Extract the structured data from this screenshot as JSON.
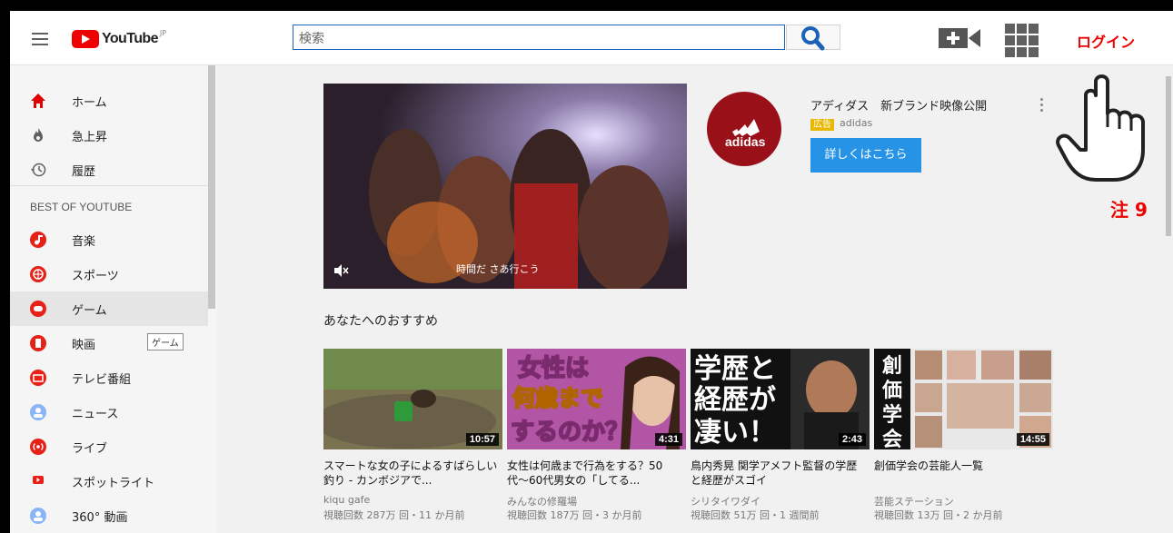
{
  "header": {
    "logo_text": "YouTube",
    "logo_region": "JP",
    "search_placeholder": "検索",
    "login_label": "ログイン"
  },
  "sidebar": {
    "items": [
      {
        "label": "ホーム",
        "icon": "home-icon",
        "color": "#e00000"
      },
      {
        "label": "急上昇",
        "icon": "flame-icon",
        "color": "#606060"
      },
      {
        "label": "履歴",
        "icon": "history-icon",
        "color": "#606060"
      }
    ],
    "section_title": "BEST OF YOUTUBE",
    "best_items": [
      {
        "label": "音楽",
        "icon": "music-icon",
        "color": "#e62117"
      },
      {
        "label": "スポーツ",
        "icon": "sports-icon",
        "color": "#e62117"
      },
      {
        "label": "ゲーム",
        "icon": "gaming-icon",
        "color": "#e62117",
        "active": true
      },
      {
        "label": "映画",
        "icon": "movie-icon",
        "color": "#e62117"
      },
      {
        "label": "テレビ番組",
        "icon": "tv-icon",
        "color": "#e62117"
      },
      {
        "label": "ニュース",
        "icon": "news-icon",
        "color": "#8ab4f8"
      },
      {
        "label": "ライブ",
        "icon": "live-icon",
        "color": "#e62117"
      },
      {
        "label": "スポットライト",
        "icon": "spotlight-icon",
        "color": "#e62117"
      },
      {
        "label": "360° 動画",
        "icon": "360-icon",
        "color": "#8ab4f8"
      }
    ],
    "tooltip": "ゲーム"
  },
  "ad": {
    "video_caption": "時間だ さあ行こう",
    "logo_text": "adidas",
    "title": "アディダス　新ブランド映像公開",
    "badge": "広告",
    "brand": "adidas",
    "button_label": "詳しくはこちら"
  },
  "annotation": {
    "note": "注 9"
  },
  "recommendations": {
    "title": "あなたへのおすすめ",
    "videos": [
      {
        "title": "スマートな女の子によるすばらしい釣り - カンボジアで...",
        "channel": "kiqu gafe",
        "views": "視聴回数 287万 回・11 か月前",
        "duration": "10:57"
      },
      {
        "title": "女性は何歳まで行為をする？50代〜60代男女の「してる...",
        "channel": "みんなの修羅場",
        "views": "視聴回数 187万 回・3 か月前",
        "duration": "4:31",
        "thumb_text": [
          "女性は",
          "何歳まで",
          "するのか？"
        ]
      },
      {
        "title": "鳥内秀晃 関学アメフト監督の学歴と経歴がスゴイ",
        "channel": "シリタイワダイ",
        "views": "視聴回数 51万 回・1 週間前",
        "duration": "2:43",
        "thumb_text": [
          "学歴と",
          "経歴が",
          "凄い！"
        ]
      },
      {
        "title": "創価学会の芸能人一覧",
        "channel": "芸能ステーション",
        "views": "視聴回数 13万 回・2 か月前",
        "duration": "14:55",
        "thumb_text": [
          "創",
          "価",
          "学",
          "会"
        ]
      }
    ]
  }
}
